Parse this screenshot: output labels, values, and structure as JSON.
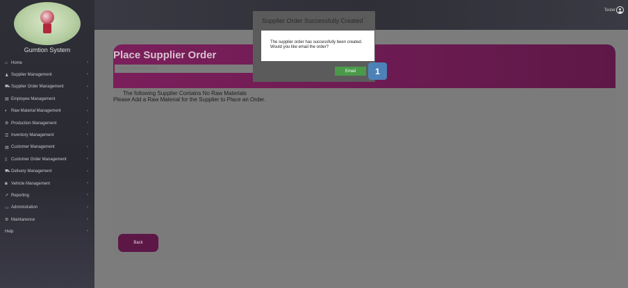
{
  "sidebar": {
    "brand": "Gumtion System",
    "items": [
      {
        "label": "Home",
        "icon": "home-icon",
        "glyph": "⌂"
      },
      {
        "label": "Supplier Management",
        "icon": "users-icon",
        "glyph": "♟"
      },
      {
        "label": "Supplier Order Management",
        "icon": "cart-icon",
        "glyph": "⛟"
      },
      {
        "label": "Employee Management",
        "icon": "id-card-icon",
        "glyph": "▤"
      },
      {
        "label": "Raw Material Management",
        "icon": "globe-icon",
        "glyph": "◐"
      },
      {
        "label": "Production Management",
        "icon": "gears-icon",
        "glyph": "⚙"
      },
      {
        "label": "Inventory Management",
        "icon": "list-icon",
        "glyph": "☰"
      },
      {
        "label": "Customer Management",
        "icon": "id-card-icon",
        "glyph": "▤"
      },
      {
        "label": "Customer Order Management",
        "icon": "file-icon",
        "glyph": "▯"
      },
      {
        "label": "Delivery Management",
        "icon": "truck-icon",
        "glyph": "⛟"
      },
      {
        "label": "Vehicle Management",
        "icon": "car-icon",
        "glyph": "◙"
      },
      {
        "label": "Reporting",
        "icon": "chart-icon",
        "glyph": "↗"
      },
      {
        "label": "Administration",
        "icon": "laptop-icon",
        "glyph": "▭"
      },
      {
        "label": "Maintanence",
        "icon": "gear-icon",
        "glyph": "⚙"
      },
      {
        "label": "Help",
        "icon": "",
        "glyph": ""
      }
    ]
  },
  "topbar": {
    "user_name": "Tester"
  },
  "main": {
    "title": "Place Supplier Order",
    "search_placeholder": "Enter Search Criteria",
    "message_line1": "The following Supplier Contains No Raw Materials",
    "message_line2": "Please Add a Raw Material for the Supplier to Place an Order.",
    "back_label": "Back"
  },
  "modal": {
    "title": "Supplier Order Successfully Created",
    "close": "×",
    "body": "The supplier order has successfully been created. Would you like email the order?",
    "email_label": "Email"
  },
  "step_badge": "1"
}
